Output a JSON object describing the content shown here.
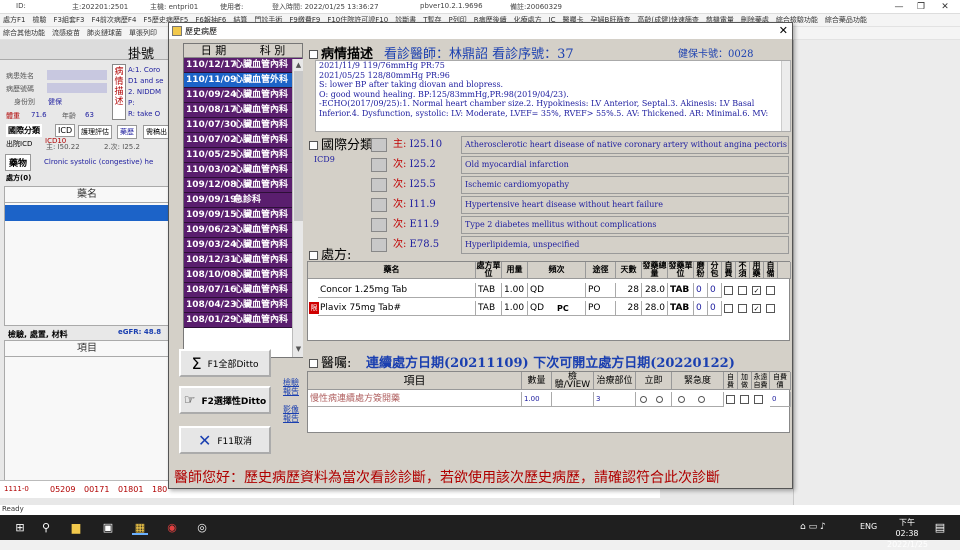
{
  "window_title": {
    "id": "ID:",
    "main": "主:202201:2501",
    "host": "主機: entpri01",
    "user": "使用者:",
    "login": "登入時間: 2022/01/25 13:36:27",
    "ver": "pbver10.2.1.9696",
    "note": "備註:20060329"
  },
  "menu1": [
    "處方F1",
    "檢驗",
    "F3組套F3",
    "F4前次病歷F4",
    "F5歷史病歷F5",
    "F6報抽F6",
    "結算",
    "門診手術",
    "F9繳費F9",
    "F10住院許可證F10",
    "診斷書",
    "T暫存",
    "P列印",
    "R病歷後續",
    "化療處方",
    "IC",
    "醫囑卡",
    "孕婦B肝篩查",
    "高齡(成健)快速篩查",
    "慈機電量",
    "刪除藥處",
    "綜合檢驗功能",
    "綜合藥品功能"
  ],
  "menu2": [
    "綜合其他功能",
    "流感疫苗",
    "肺炎鏈球菌",
    "單張列印"
  ],
  "background": {
    "tab": "掛號",
    "patient_name_label": "病患姓名",
    "chart_no_label": "病歷號碼",
    "identity_label": "身份別",
    "identity_value": "健保",
    "weight_label": "體重",
    "weight_value": "71.6",
    "age_label": "年齡",
    "age_value": "63",
    "condition_label": "病情描述",
    "diag_lines": [
      "A:1. Coro",
      "D1 and se",
      "2. NIDDM",
      "P:",
      "R: take O"
    ],
    "intl_tab": "國際分類",
    "icd_tab": "ICD",
    "care_tab": "護理評估",
    "drug_tab": "藥歷",
    "tab_out": "需稿出",
    "out_icd": "出院ICD",
    "icd10": "ICD10",
    "main_dx": "主: I50.22",
    "secondary": "2.次: I25.2",
    "drug_label": "藥物",
    "drug_line": "Clronic systolic (congestive) he",
    "rx_count": "處方(0)",
    "rx_col_name": "藥名",
    "lab_label": "檢驗, 處置, 材料",
    "egfr": "eGFR: 48.8",
    "item_col": "項目",
    "bottom_red": "1111-0",
    "bottom_codes": [
      "05209",
      "00171",
      "01801",
      "180"
    ]
  },
  "status_text": "Ready",
  "taskbar": {
    "time": "下午 02:38",
    "date": "2022/1/25",
    "lang": "ENG"
  },
  "dialog": {
    "title": "歷史病歷",
    "list_headers": [
      "日 期",
      "科 別"
    ],
    "list_rows": [
      {
        "date": "110/12/17",
        "dept": "心臟血管內科"
      },
      {
        "date": "110/11/09",
        "dept": "心臟血管外科"
      },
      {
        "date": "110/09/24",
        "dept": "心臟血管內科"
      },
      {
        "date": "110/08/17",
        "dept": "心臟血管內科"
      },
      {
        "date": "110/07/30",
        "dept": "心臟血管內科"
      },
      {
        "date": "110/07/02",
        "dept": "心臟血管內科"
      },
      {
        "date": "110/05/25",
        "dept": "心臟血管內科"
      },
      {
        "date": "110/03/02",
        "dept": "心臟血管內科"
      },
      {
        "date": "109/12/08",
        "dept": "心臟血管內科"
      },
      {
        "date": "109/09/19",
        "dept": "急診科"
      },
      {
        "date": "109/09/15",
        "dept": "心臟血管內科"
      },
      {
        "date": "109/06/23",
        "dept": "心臟血管內科"
      },
      {
        "date": "109/03/24",
        "dept": "心臟血管內科"
      },
      {
        "date": "108/12/31",
        "dept": "心臟血管內科"
      },
      {
        "date": "108/10/08",
        "dept": "心臟血管內科"
      },
      {
        "date": "108/07/16",
        "dept": "心臟血管內科"
      },
      {
        "date": "108/04/23",
        "dept": "心臟血管內科"
      },
      {
        "date": "108/01/29",
        "dept": "心臟血管內科"
      }
    ],
    "btn_all": "F1全部Ditto",
    "btn_select": "F2選擇性Ditto",
    "btn_cancel": "F11取消",
    "link_report1": "檢驗報告",
    "link_report2": "影像報告",
    "cond_label": "病情描述",
    "doctor_info": "看診醫師：林鼎詔  看診序號：37",
    "insurance": "健保卡號：0028",
    "notes": [
      "2021/11/9 119/76mmHg PR:75",
      "2021/05/25  128/80mmHg PR:96",
      "S: lower BP after taking diovan and blopress.",
      "O:  good wound healing. BP:125/83mmHg,PR:98(2019/04/23).",
      "-ECHO(2017/09/25):1. Normal heart chamber size.2. Hypokinesis: LV Anterior, Septal.3. Akinesis: LV Basal",
      "Inferior.4. Dysfunction, systolic: LV: Moderate, LVEF= 35%, RVEF> 55%.5. AV: Thickened.  AR: Minimal.6. MV:"
    ],
    "intl_label": "國際分類:",
    "icd9": "ICD9",
    "diagnoses": [
      {
        "tag": "主:",
        "code": "I25.10",
        "desc": "Atherosclerotic heart disease of native coronary artery without angina pectoris"
      },
      {
        "tag": "次:",
        "code": "I25.2",
        "desc": "Old myocardial infarction"
      },
      {
        "tag": "次:",
        "code": "I25.5",
        "desc": "Ischemic cardiomyopathy"
      },
      {
        "tag": "次:",
        "code": "I11.9",
        "desc": "Hypertensive heart disease without heart failure"
      },
      {
        "tag": "次:",
        "code": "E11.9",
        "desc": "Type 2 diabetes mellitus without complications"
      },
      {
        "tag": "次:",
        "code": "E78.5",
        "desc": "Hyperlipidemia, unspecified"
      }
    ],
    "rx_label": "處方:",
    "rx_headers": [
      "藥名",
      "處方單位",
      "用量",
      "頻次",
      "途徑",
      "天數",
      "發藥總量",
      "發藥單位",
      "磨粉",
      "分包",
      "自費",
      "不須",
      "用藥",
      "自備"
    ],
    "rx_rows": [
      {
        "name": "Concor 1.25mg Tab",
        "unit": "TAB",
        "dose": "1.00",
        "freq": "QD",
        "pc": "",
        "route": "PO",
        "days": "28",
        "total": "28.0",
        "dunit": "TAB",
        "g": "0",
        "p": "0",
        "flag": false
      },
      {
        "name": "Plavix 75mg Tab#",
        "unit": "TAB",
        "dose": "1.00",
        "freq": "QD",
        "pc": "PC",
        "route": "PO",
        "days": "28",
        "total": "28.0",
        "dunit": "TAB",
        "g": "0",
        "p": "0",
        "flag": true
      }
    ],
    "orders_label": "醫囑:",
    "continuous_rx": "連續處方日期(20211109)  下次可開立處方日期(20220122)",
    "order_headers": [
      "項目",
      "數量",
      "檢驗/VIEW",
      "治療部位",
      "立即",
      "緊急度",
      "自費",
      "加做",
      "永遠自費",
      "自費價"
    ],
    "order_row": {
      "item": "慢性病連續處方簽開藥",
      "qty": "1.00",
      "site": "3",
      "price": "0"
    },
    "banner": "醫師您好：歷史病歷資料為當次看診診斷，若欲使用該次歷史病歷，請確認符合此次診斷"
  }
}
